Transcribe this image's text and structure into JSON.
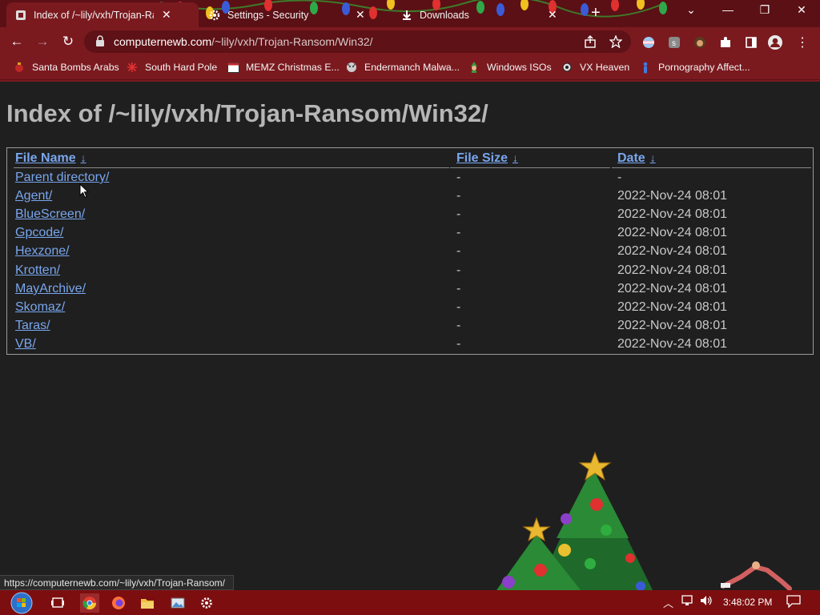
{
  "tabs": [
    {
      "title": "Index of /~lily/vxh/Trojan-Ranso",
      "active": true
    },
    {
      "title": "Settings - Security",
      "active": false
    },
    {
      "title": "Downloads",
      "active": false
    }
  ],
  "address_bar": {
    "host": "computernewb.com",
    "path": "/~lily/vxh/Trojan-Ransom/Win32/"
  },
  "bookmarks": [
    {
      "label": "Santa Bombs Arabs",
      "icon": "ornament-icon"
    },
    {
      "label": "South Hard Pole",
      "icon": "snowflake-icon"
    },
    {
      "label": "MEMZ Christmas E...",
      "icon": "window-icon"
    },
    {
      "label": "Endermanch Malwa...",
      "icon": "wolf-icon"
    },
    {
      "label": "Windows ISOs",
      "icon": "elf-icon"
    },
    {
      "label": "VX Heaven",
      "icon": "virus-icon"
    },
    {
      "label": "Pornography Affect...",
      "icon": "figure-icon"
    }
  ],
  "page": {
    "heading": "Index of /~lily/vxh/Trojan-Ransom/Win32/",
    "columns": {
      "name": "File Name",
      "size": "File Size",
      "date": "Date",
      "sort_arrow": "↓"
    },
    "rows": [
      {
        "name": "Parent directory/",
        "size": "-",
        "date": "-"
      },
      {
        "name": "Agent/",
        "size": "-",
        "date": "2022-Nov-24 08:01"
      },
      {
        "name": "BlueScreen/",
        "size": "-",
        "date": "2022-Nov-24 08:01"
      },
      {
        "name": "Gpcode/",
        "size": "-",
        "date": "2022-Nov-24 08:01"
      },
      {
        "name": "Hexzone/",
        "size": "-",
        "date": "2022-Nov-24 08:01"
      },
      {
        "name": "Krotten/",
        "size": "-",
        "date": "2022-Nov-24 08:01"
      },
      {
        "name": "MayArchive/",
        "size": "-",
        "date": "2022-Nov-24 08:01"
      },
      {
        "name": "Skomaz/",
        "size": "-",
        "date": "2022-Nov-24 08:01"
      },
      {
        "name": "Taras/",
        "size": "-",
        "date": "2022-Nov-24 08:01"
      },
      {
        "name": "VB/",
        "size": "-",
        "date": "2022-Nov-24 08:01"
      }
    ]
  },
  "status_url": "https://computernewb.com/~lily/vxh/Trojan-Ransom/",
  "taskbar": {
    "apps": [
      "start-orb-icon",
      "task-view-icon",
      "chrome-icon",
      "firefox-icon",
      "file-explorer-icon",
      "photos-icon",
      "settings-icon"
    ],
    "clock": "3:48:02 PM"
  },
  "colors": {
    "link": "#79a6ee",
    "chrome": "#7a1a1f",
    "taskbar": "#7d0e0f",
    "page_bg": "#1f1f1f"
  }
}
